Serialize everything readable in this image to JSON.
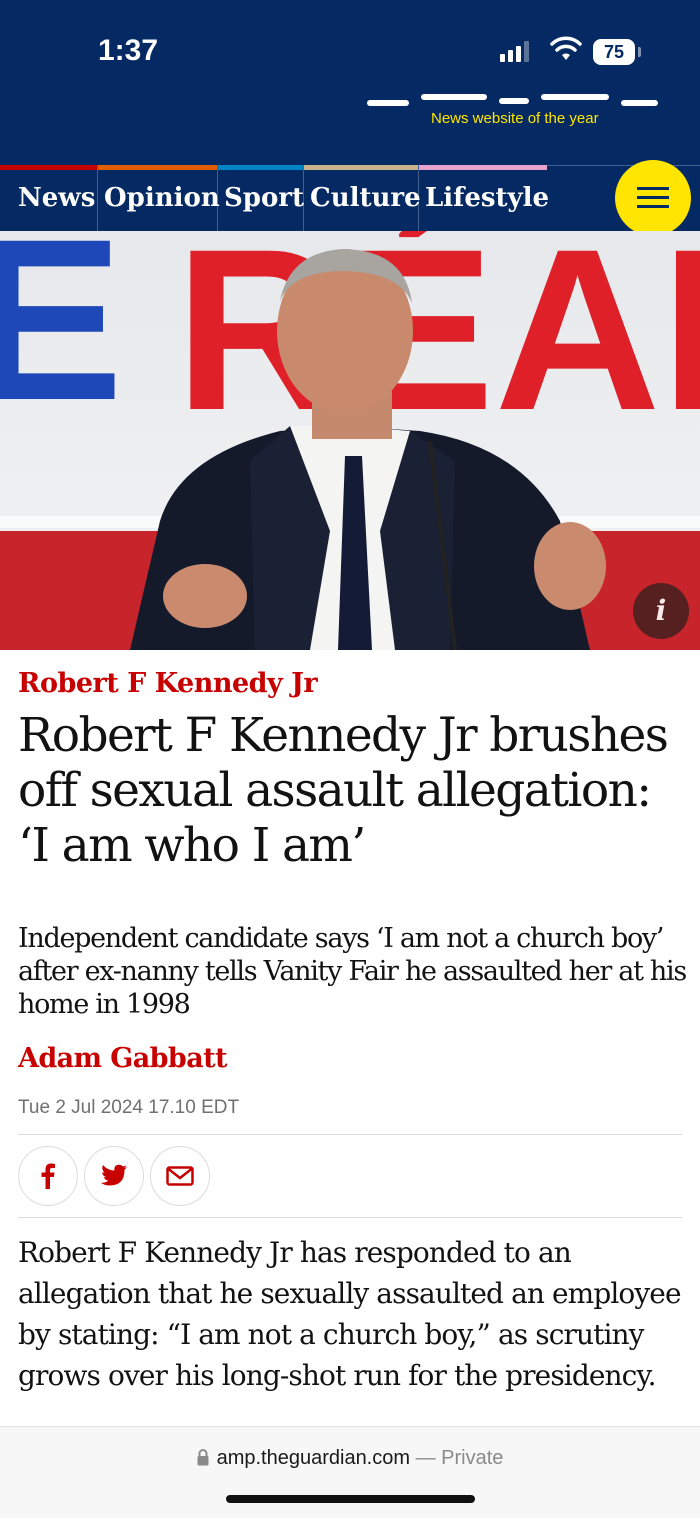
{
  "status_bar": {
    "time": "1:37",
    "battery": "75"
  },
  "masthead": {
    "tagline": "News website of the year"
  },
  "nav": {
    "items": [
      {
        "label": "News",
        "accent": "#c70000"
      },
      {
        "label": "Opinion",
        "accent": "#e05e00"
      },
      {
        "label": "Sport",
        "accent": "#0084c6"
      },
      {
        "label": "Culture",
        "accent": "#a1845c"
      },
      {
        "label": "Lifestyle",
        "accent": "#bb3b80"
      }
    ],
    "menu_icon": "hamburger-icon"
  },
  "hero": {
    "sign_text": "ERÉAL",
    "info_label": "i"
  },
  "article": {
    "kicker": "Robert F Kennedy Jr",
    "headline": "Robert F Kennedy Jr brushes off sexual assault allegation: ‘I am who I am’",
    "standfirst": "Independent candidate says ‘I am not a church boy’ after ex-nanny tells Vanity Fair he assaulted her at his home in 1998",
    "byline": "Adam Gabbatt",
    "dateline": "Tue 2 Jul 2024 17.10 EDT",
    "share": [
      "facebook-icon",
      "twitter-icon",
      "email-icon"
    ],
    "body": "Robert F Kennedy Jr has responded to an allegation that he sexually assaulted an employee by stating: “I am not a church boy,” as scrutiny grows over his long-shot run for the presidency."
  },
  "browser": {
    "domain": "amp.theguardian.com",
    "mode": "— Private"
  },
  "colors": {
    "brand": "#052962",
    "accent": "#c70000",
    "highlight": "#ffe500"
  }
}
